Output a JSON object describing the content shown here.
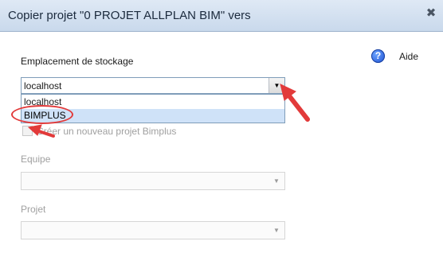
{
  "titlebar": {
    "title": "Copier projet \"0 PROJET ALLPLAN BIM\" vers",
    "close_icon": "close-icon"
  },
  "help": {
    "icon": "help-icon",
    "label": "Aide"
  },
  "storage": {
    "label": "Emplacement de stockage",
    "selected": "localhost",
    "options": [
      "localhost",
      "BIMPLUS"
    ],
    "highlighted_option": "BIMPLUS"
  },
  "new_project": {
    "label": "Créer un nouveau projet Bimplus",
    "checked": false
  },
  "team": {
    "label": "Equipe",
    "value": ""
  },
  "project": {
    "label": "Projet",
    "value": ""
  },
  "annotation": {
    "color": "#e23a3a",
    "arrow_icons": [
      "arrow-icon",
      "arrow-icon"
    ]
  },
  "colors": {
    "titlebar": "#c9d9ec",
    "highlight": "#cfe2f8",
    "disabled_text": "#a0a0a0"
  }
}
